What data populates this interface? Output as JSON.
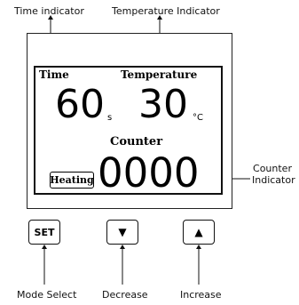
{
  "annotations": {
    "time_indicator": "Time indicator",
    "temperature_indicator": "Temperature Indicator",
    "counter_indicator_line1": "Counter",
    "counter_indicator_line2": "Indicator",
    "mode_select": "Mode Select",
    "decrease": "Decrease",
    "increase": "Increase"
  },
  "display": {
    "time_label": "Time",
    "temperature_label": "Temperature",
    "time_value": "60",
    "time_unit": "s",
    "temperature_value": "30",
    "temperature_unit": "°C",
    "counter_label": "Counter",
    "counter_value": "0000",
    "status_label": "Heating"
  },
  "buttons": {
    "set_label": "SET",
    "decrease_icon": "triangle-down-icon",
    "increase_icon": "triangle-up-icon"
  }
}
